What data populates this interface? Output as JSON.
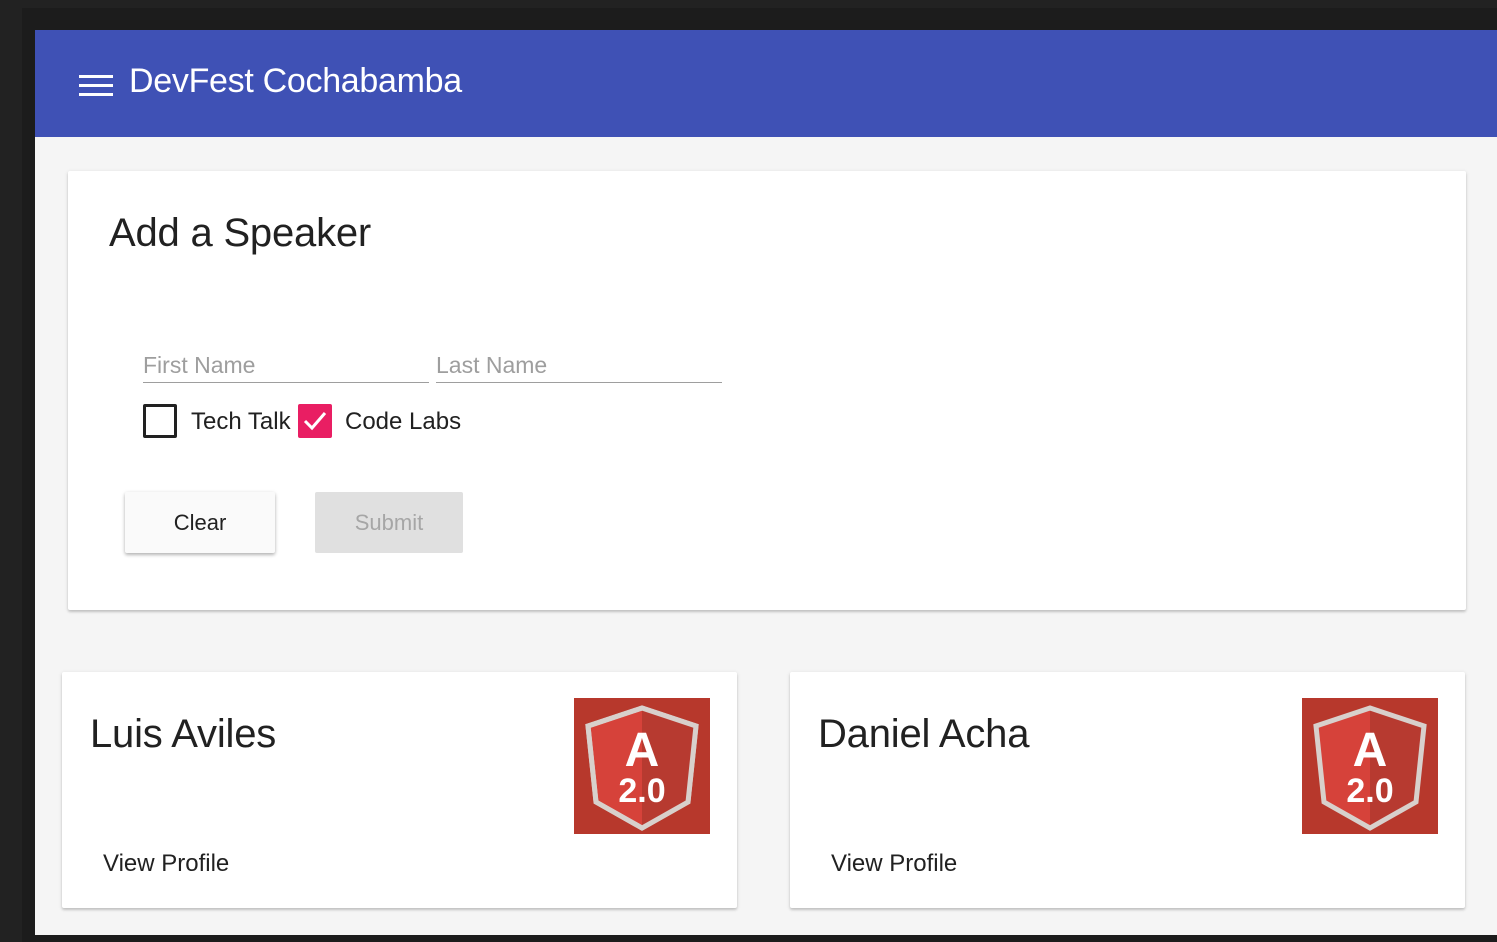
{
  "toolbar": {
    "menu_icon": "menu-icon",
    "title": "DevFest Cochabamba",
    "color": "#3f51b5"
  },
  "form": {
    "title": "Add a Speaker",
    "first_name": {
      "placeholder": "First Name",
      "value": ""
    },
    "last_name": {
      "placeholder": "Last Name",
      "value": ""
    },
    "checkboxes": [
      {
        "label": "Tech Talk",
        "checked": false
      },
      {
        "label": "Code Labs",
        "checked": true,
        "color": "#e91e63"
      }
    ],
    "clear_label": "Clear",
    "submit_label": "Submit",
    "submit_disabled": true
  },
  "speakers": [
    {
      "name": "Luis Aviles",
      "image_icon": "angular-2-logo-icon",
      "action_label": "View Profile"
    },
    {
      "name": "Daniel Acha",
      "image_icon": "angular-2-logo-icon",
      "action_label": "View Profile"
    }
  ],
  "logo_text": {
    "letter": "A",
    "version": "2.0"
  }
}
